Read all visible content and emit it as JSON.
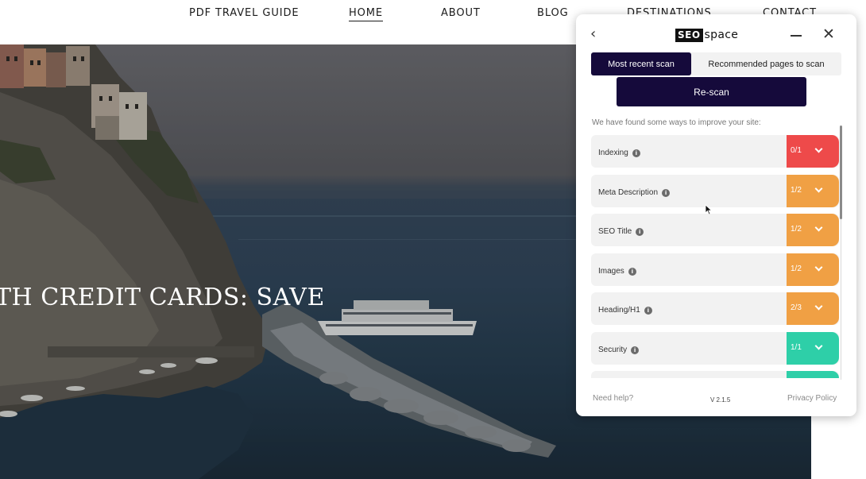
{
  "nav": {
    "items": [
      {
        "label": "PDF TRAVEL GUIDE",
        "active": false
      },
      {
        "label": "HOME",
        "active": true
      },
      {
        "label": "ABOUT",
        "active": false
      },
      {
        "label": "BLOG",
        "active": false
      },
      {
        "label": "DESTINATIONS",
        "active": false
      },
      {
        "label": "CONTACT",
        "active": false
      }
    ]
  },
  "hero": {
    "headline": "TH CREDIT CARDS: SAVE"
  },
  "panel": {
    "logo": {
      "box_text": "SEO",
      "word": "space"
    },
    "back_icon": "chevron-left-icon",
    "tabs": [
      {
        "label": "Most recent scan",
        "active": true
      },
      {
        "label": "Recommended pages to scan",
        "active": false
      }
    ],
    "rescan_label": "Re-scan",
    "found_text": "We have found some ways to improve your site:",
    "checks": [
      {
        "label": "Indexing",
        "score": "0/1",
        "status": "fail"
      },
      {
        "label": "Meta Description",
        "score": "1/2",
        "status": "partial"
      },
      {
        "label": "SEO Title",
        "score": "1/2",
        "status": "partial"
      },
      {
        "label": "Images",
        "score": "1/2",
        "status": "partial"
      },
      {
        "label": "Heading/H1",
        "score": "2/3",
        "status": "partial"
      },
      {
        "label": "Security",
        "score": "1/1",
        "status": "pass"
      },
      {
        "label": "",
        "score": "",
        "status": "pass"
      }
    ],
    "footer": {
      "help": "Need help?",
      "version": "V 2.1.5",
      "privacy": "Privacy Policy"
    }
  },
  "colors": {
    "fail": "#ee4a4a",
    "partial": "#f0a044",
    "pass": "#2ecfa8",
    "brand": "#150a3b"
  }
}
